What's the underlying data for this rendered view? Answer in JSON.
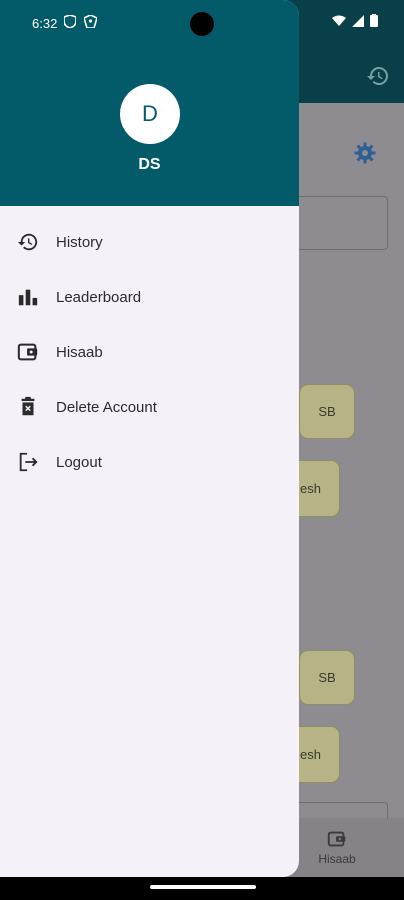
{
  "status_bar": {
    "time": "6:32"
  },
  "background": {
    "chips": [
      {
        "label": "SB"
      },
      {
        "label": "esh"
      },
      {
        "label": "SB"
      },
      {
        "label": "esh"
      }
    ],
    "bottom_nav": {
      "label": "Hisaab"
    }
  },
  "drawer": {
    "avatar_initial": "D",
    "user_name": "DS",
    "menu": [
      {
        "label": "History",
        "icon": "history-icon"
      },
      {
        "label": "Leaderboard",
        "icon": "leaderboard-icon"
      },
      {
        "label": "Hisaab",
        "icon": "wallet-icon"
      },
      {
        "label": "Delete Account",
        "icon": "trash-icon"
      },
      {
        "label": "Logout",
        "icon": "logout-icon"
      }
    ]
  },
  "colors": {
    "header": "#035a68",
    "drawer_bg": "#f6f1f8",
    "scrim": "#8f8c91"
  }
}
